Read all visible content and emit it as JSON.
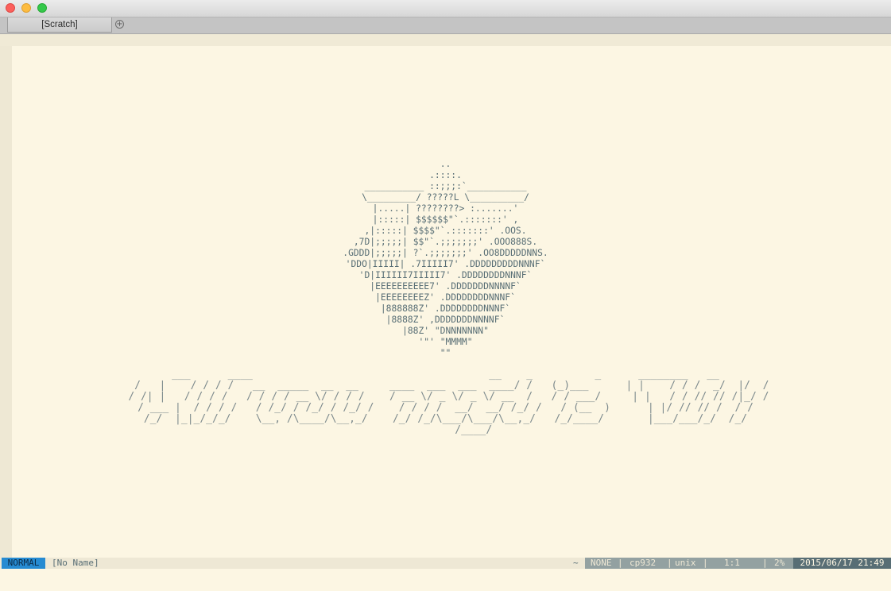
{
  "window": {
    "tab_label": "[Scratch]",
    "tab_add_symbol": "+"
  },
  "editor": {
    "logo_art": "..\n.::::.\n___________ ::;;;:`___________\n\\_________/ ?????L \\__________/\n|.....| ????????> :.......'\n|:::::| $$$$$$\"`.:::::::' ,\n,|:::::| $$$$\"`.:::::::' .OOS.\n,7D|;;;;;| $$\"`.;;;;;;;' .OOO888S.\n.GDDD|;;;;;| ?`.;;;;;;;' .OO8DDDDDNNS.\n'DDO|IIIII| .7IIIII7' .DDDDDDDDDNNNF`\n'D|IIIIII7IIIII7' .DDDDDDDDNNNF`\n|EEEEEEEEEE7' .DDDDDDDNNNNF`\n|EEEEEEEEZ' .DDDDDDDDNNNF`\n|888888Z' .DDDDDDDDNNNF`\n|8888Z' ,DDDDDDDNNNNF`\n|88Z' \"DNNNNNNN\"\n'\"' \"MMMM\"\n\"\"",
    "banner_art": "___      ____                                      __    _          _      ________   __\n  /   |    / / / /   __  _____  __  __     ____  ___  ___  ____/ /   (_)___      | |    / / /  _/  |/  /\n / /| |   / / / /   / / / / __ \\/ / / /    / __ \\/ _ \\/ _ \\/ __  /   / / ___/     | |   / / // // /|_/ /\n/ ___ |  / / / /   / /_/ / /_/ / /_/ /    / / / /  __/  __/ /_/ /   / (__  )      | |/ // // /  / /\n/_/  |_|_/_/_/    \\__, /\\____/\\__,_/    /_/ /_/\\___/\\___/\\__,_/   /_/____/       |___/___/_/  /_/\n         /____/"
  },
  "statusline": {
    "mode": "NORMAL",
    "buffer_name": "[No Name]",
    "tilde": "~",
    "encoding_none": "NONE",
    "sep1": "|",
    "encoding": "cp932",
    "sep2": "|",
    "fileformat": "unix",
    "sep3": "|",
    "position": "1:1",
    "sep4": "|",
    "percent": "2%",
    "datetime": "2015/06/17 21:49"
  },
  "colors": {
    "background": "#fcf6e3",
    "mode_bg": "#268bd2",
    "info_bg": "#93a1a1",
    "datetime_bg": "#586e75",
    "text": "#586e75"
  }
}
